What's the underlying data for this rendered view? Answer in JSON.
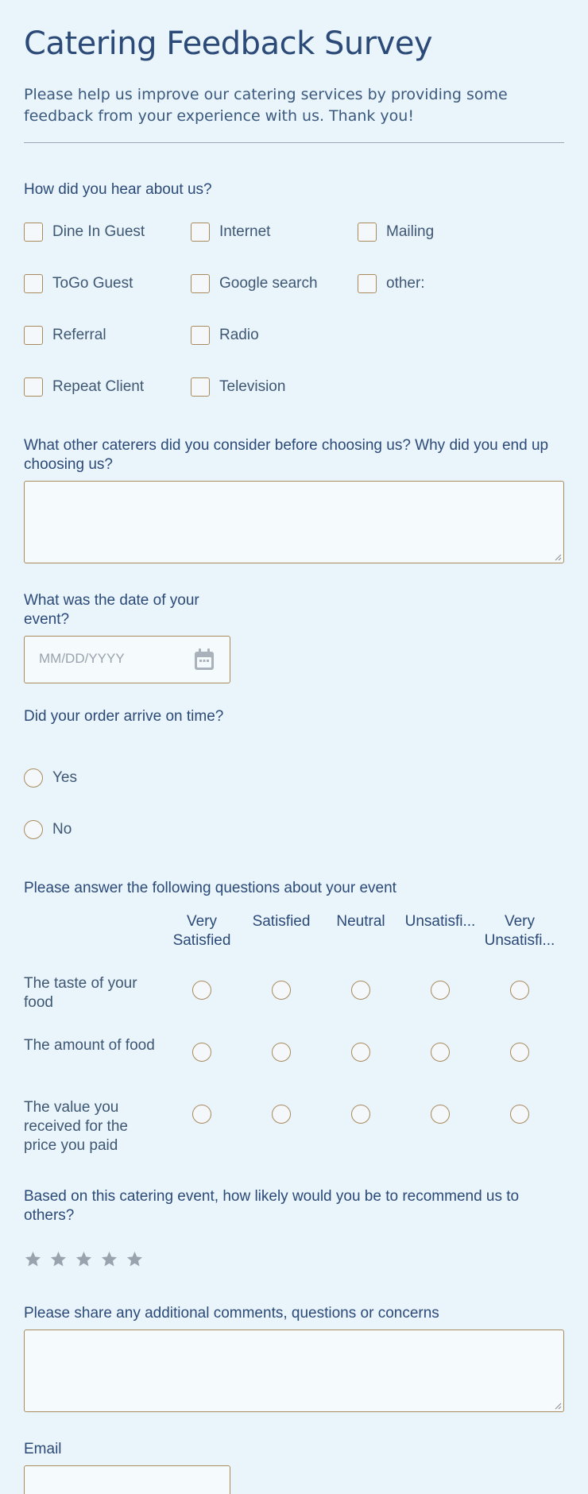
{
  "header": {
    "title": "Catering Feedback Survey",
    "subtitle": "Please help us improve our catering services by providing some feedback from your experience with us. Thank you!"
  },
  "hear_about": {
    "label": "How did you hear about us?",
    "options": [
      "Dine In Guest",
      "Internet",
      "Mailing",
      "ToGo Guest",
      "Google search",
      "other:",
      "Referral",
      "Radio",
      "Repeat Client",
      "Television"
    ]
  },
  "other_caterers": {
    "label": "What other caterers did you consider before choosing us? Why did you end up choosing us?",
    "value": ""
  },
  "event_date": {
    "label": "What was the date of your event?",
    "placeholder": "MM/DD/YYYY",
    "icon": "calendar-icon"
  },
  "on_time": {
    "label": "Did your order arrive on time?",
    "options": [
      "Yes",
      "No"
    ]
  },
  "matrix": {
    "label": "Please answer the following questions about your event",
    "columns": [
      "Very Satisfied",
      "Satisfied",
      "Neutral",
      "Unsatisfi...",
      "Very Unsatisfi..."
    ],
    "rows": [
      "The taste of your food",
      "The amount of food",
      "The value you received for the price you paid"
    ]
  },
  "recommend": {
    "label": "Based on this catering event, how likely would you be to recommend us to others?",
    "max_stars": 5,
    "rating": 0
  },
  "comments": {
    "label": "Please share any additional comments, questions or concerns",
    "value": ""
  },
  "email": {
    "label": "Email",
    "value": ""
  },
  "colors": {
    "background": "#eaf4fb",
    "heading": "#2b4a78",
    "border": "#a88a5c",
    "star": "#9aa3ad"
  }
}
